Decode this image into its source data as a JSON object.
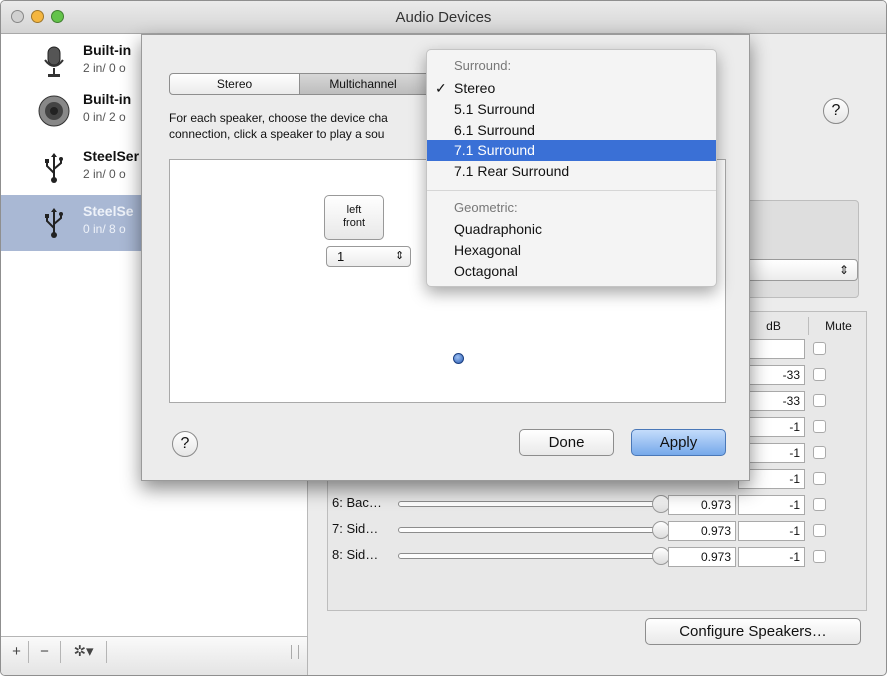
{
  "window": {
    "title": "Audio Devices"
  },
  "sidebar": {
    "devices": [
      {
        "name": "Built-in",
        "sub": "2 in/ 0 o",
        "icon": "microphone-icon"
      },
      {
        "name": "Built-in",
        "sub": "0 in/ 2 o",
        "icon": "speaker-icon"
      },
      {
        "name": "SteelSer",
        "sub": "2 in/ 0 o",
        "icon": "usb-icon"
      },
      {
        "name": "SteelSe",
        "sub": "0 in/ 8 o",
        "icon": "usb-icon"
      }
    ],
    "add_label": "+",
    "remove_label": "−",
    "gear_label": "✲▾"
  },
  "main": {
    "columns": {
      "db": "dB",
      "mute": "Mute"
    },
    "rows": [
      {
        "label": "",
        "value": "",
        "db": ""
      },
      {
        "label": "",
        "value": "",
        "db": "-33"
      },
      {
        "label": "",
        "value": "",
        "db": "-33"
      },
      {
        "label": "",
        "value": "",
        "db": "-1"
      },
      {
        "label": "",
        "value": "",
        "db": "-1"
      },
      {
        "label": "",
        "value": "",
        "db": "-1"
      },
      {
        "label": "6: Bac…",
        "value": "0.973",
        "db": "-1"
      },
      {
        "label": "7: Sid…",
        "value": "0.973",
        "db": "-1"
      },
      {
        "label": "8: Sid…",
        "value": "0.973",
        "db": "-1"
      }
    ],
    "configure_label": "Configure Speakers…",
    "help_label": "?"
  },
  "sheet": {
    "tabs": [
      "Stereo",
      "Multichannel"
    ],
    "instructions_1": "For each speaker, choose the device cha",
    "instructions_2": "connection, click a speaker to play a sou",
    "speaker_label_1": "left",
    "speaker_label_2": "front",
    "channel_value": "1",
    "done_label": "Done",
    "apply_label": "Apply",
    "help_label": "?"
  },
  "menu": {
    "header_surround": "Surround:",
    "items_surround": [
      "Stereo",
      "5.1 Surround",
      "6.1 Surround",
      "7.1 Surround",
      "7.1 Rear Surround"
    ],
    "header_geometric": "Geometric:",
    "items_geometric": [
      "Quadraphonic",
      "Hexagonal",
      "Octagonal"
    ],
    "checked_item": "Stereo",
    "highlighted_item": "7.1 Surround",
    "check_mark": "✓"
  },
  "colors": {
    "selection": "#3a70d6",
    "sidebar_selection": "#a9b8d4",
    "apply_button": "#8fb8ec"
  }
}
